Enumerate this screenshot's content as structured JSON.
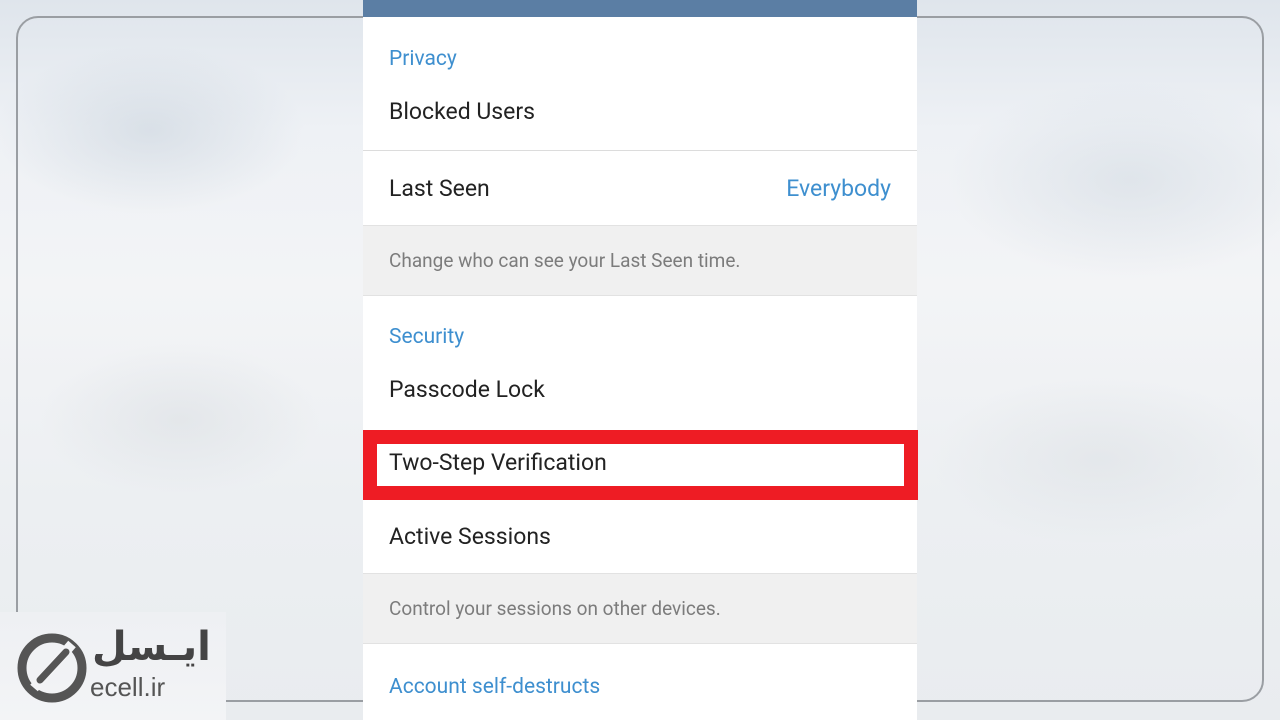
{
  "privacy": {
    "header": "Privacy",
    "blocked_users": "Blocked Users",
    "last_seen": "Last Seen",
    "last_seen_value": "Everybody",
    "last_seen_hint": "Change who can see your Last Seen time."
  },
  "security": {
    "header": "Security",
    "passcode_lock": "Passcode Lock",
    "two_step": "Two-Step Verification",
    "active_sessions": "Active Sessions",
    "sessions_hint": "Control your sessions on other devices."
  },
  "account": {
    "header": "Account self-destructs"
  },
  "watermark": {
    "latin": "ecell.ir",
    "persian": "ایـسل"
  },
  "colors": {
    "accent": "#3e8fcf",
    "topbar": "#5b7ea4",
    "highlight": "#ee1c24"
  }
}
